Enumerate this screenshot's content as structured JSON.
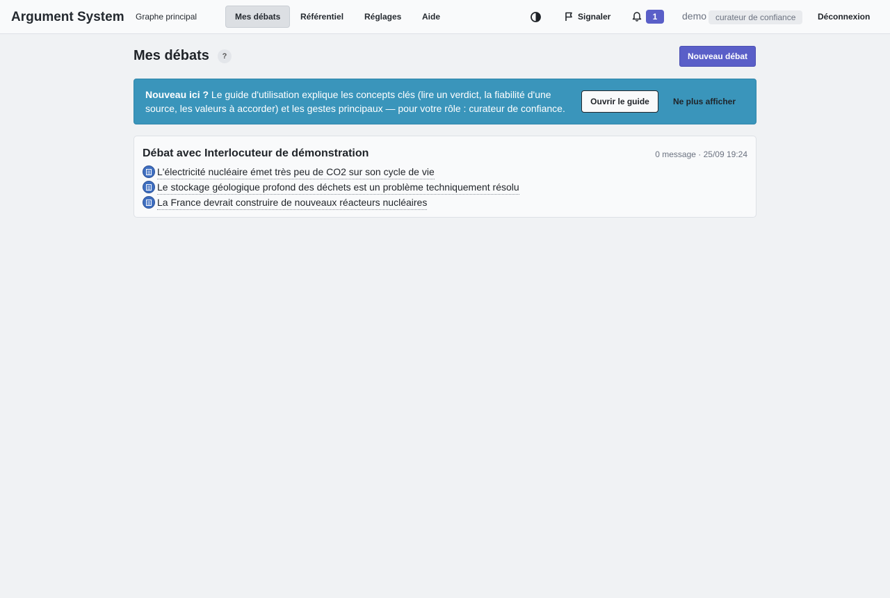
{
  "topbar": {
    "brand": "Argument System",
    "nav": [
      {
        "label": "Graphe principal"
      },
      {
        "label": "Mes débats"
      },
      {
        "label": "Référentiel"
      },
      {
        "label": "Réglages"
      },
      {
        "label": "Aide"
      }
    ],
    "active_nav": "Mes débats",
    "contrast_icon": "contrast-icon",
    "signal_label": "Signaler",
    "signal_icon": "flag-icon",
    "notif_icon": "bell-icon",
    "notif_count": "1",
    "user_name": "demo",
    "user_role": "curateur de confiance",
    "logout_label": "Déconnexion"
  },
  "header": {
    "title": "Mes débats",
    "help_label": "?",
    "new_button_label": "Nouveau débat"
  },
  "banner": {
    "lead": "Nouveau ici ?",
    "text": " Le guide d'utilisation explique les concepts clés (lire un verdict, la fiabilité d'une source, les valeurs à accorder) et les gestes principaux — pour votre rôle : curateur de confiance.",
    "open_guide_label": "Ouvrir le guide",
    "dismiss_label": "Ne plus afficher"
  },
  "debates": [
    {
      "title": "Débat avec Interlocuteur de démonstration",
      "meta": "0 message · 25/09 19:24",
      "claims": [
        {
          "text": "L'électricité nucléaire émet très peu de CO2 sur son cycle de vie",
          "icon": "document-icon"
        },
        {
          "text": "Le stockage géologique profond des déchets est un problème techniquement résolu",
          "icon": "document-icon"
        },
        {
          "text": "La France devrait construire de nouveaux réacteurs nucléaires",
          "icon": "document-icon"
        }
      ]
    }
  ],
  "colors": {
    "accent": "#5a5fc8",
    "banner": "#3a95bb",
    "claim_icon": "#3f6fc0"
  }
}
